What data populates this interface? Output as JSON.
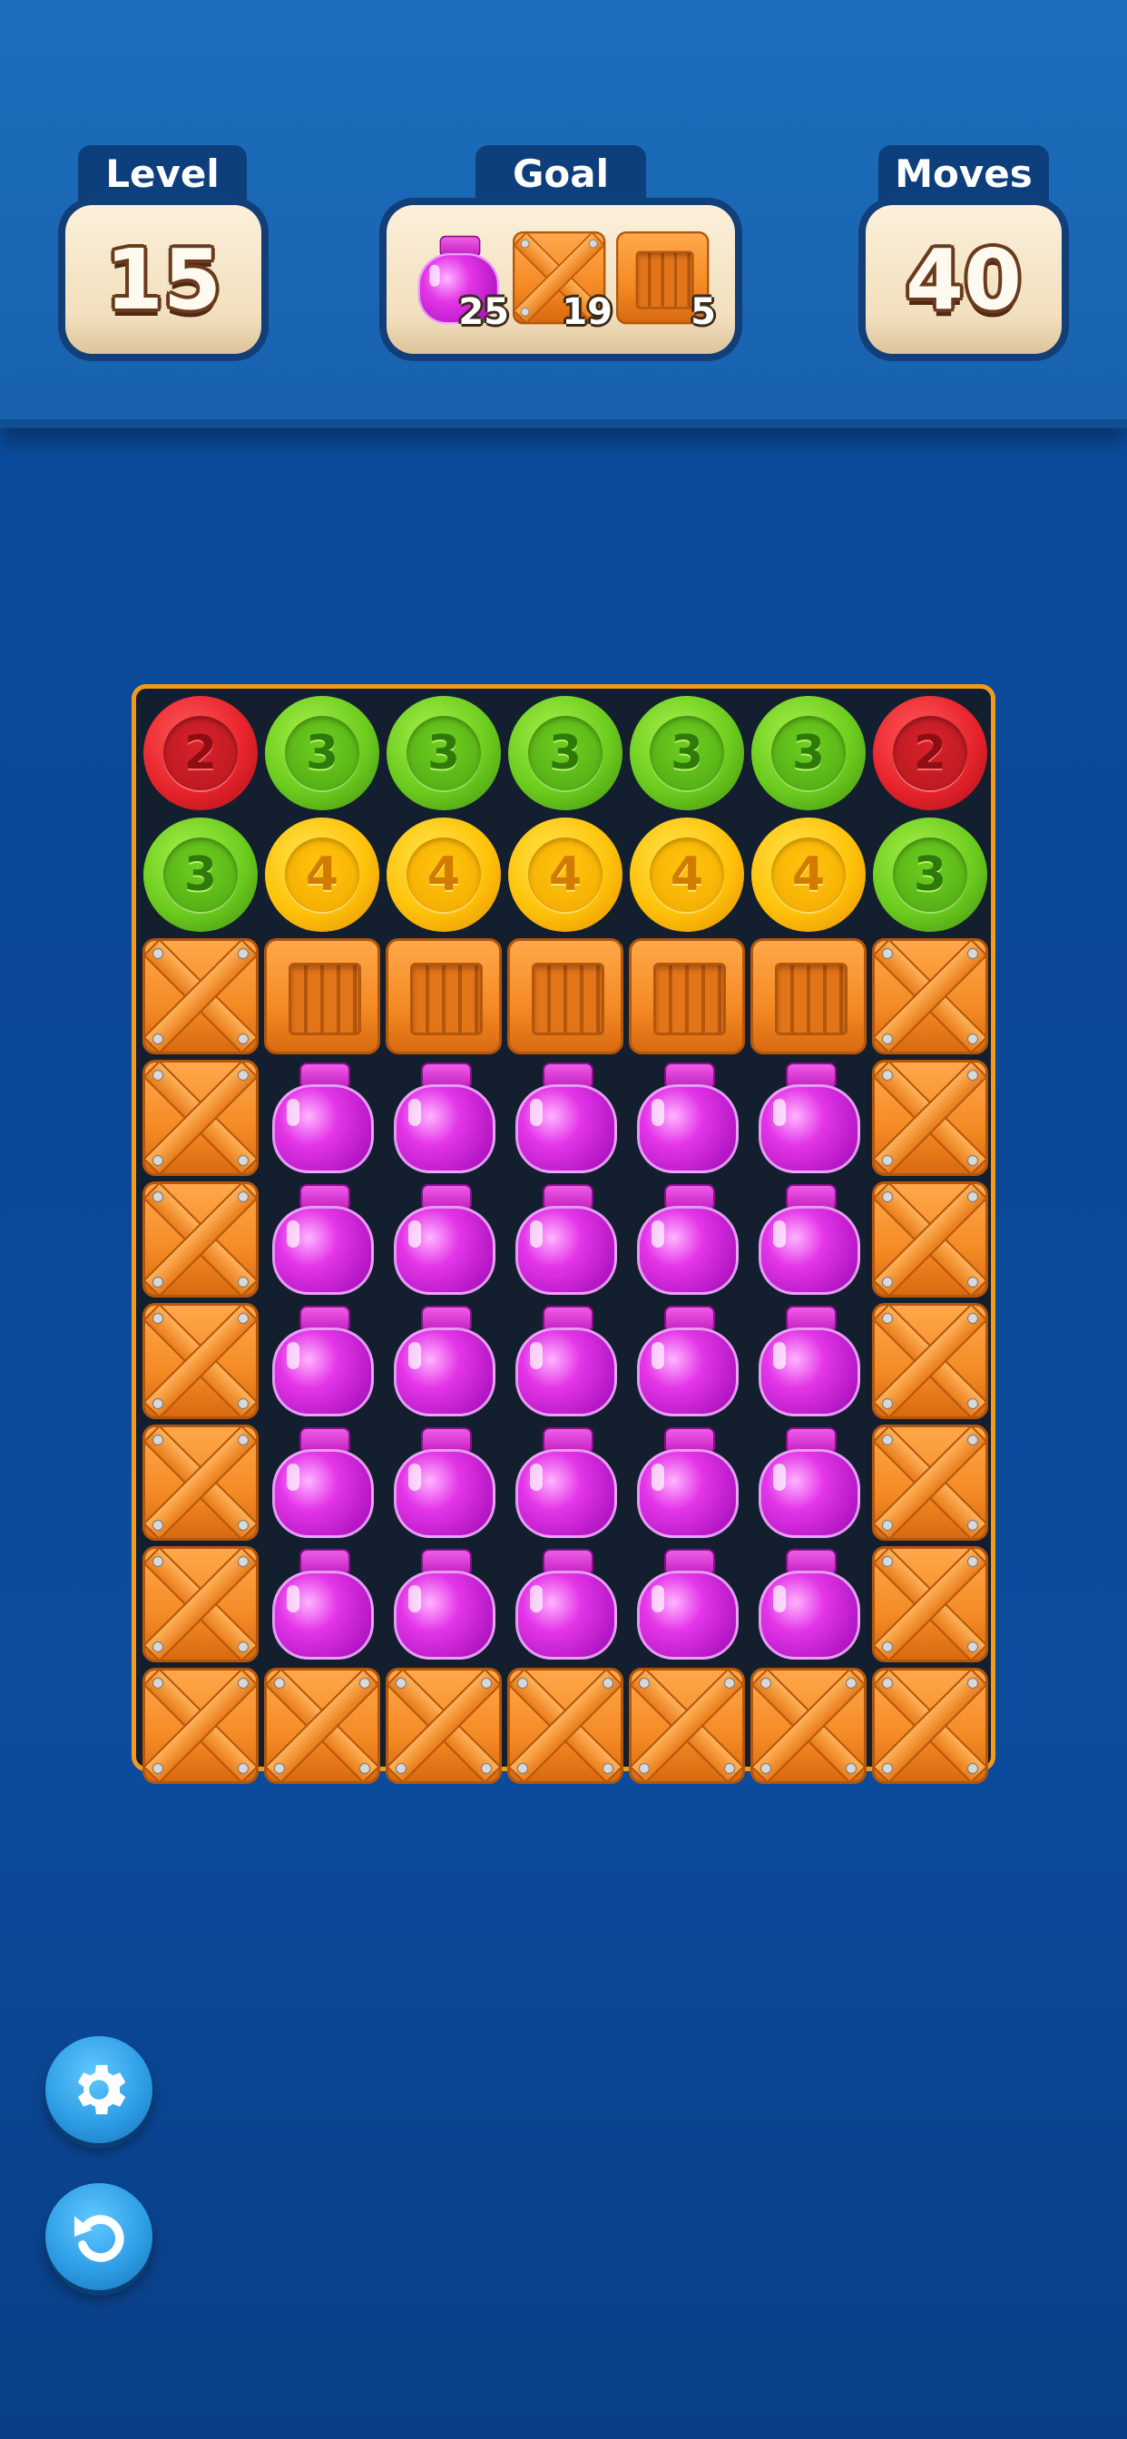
{
  "hud": {
    "level": {
      "label": "Level",
      "value": "15"
    },
    "goal": {
      "label": "Goal",
      "items": [
        {
          "icon": "jar-icon",
          "count": "25"
        },
        {
          "icon": "crate-icon",
          "count": "19"
        },
        {
          "icon": "plank-icon",
          "count": "5"
        }
      ]
    },
    "moves": {
      "label": "Moves",
      "value": "40"
    }
  },
  "board": {
    "rows": [
      [
        "chip-red:2",
        "chip-green:3",
        "chip-green:3",
        "chip-green:3",
        "chip-green:3",
        "chip-green:3",
        "chip-red:2"
      ],
      [
        "chip-green:3",
        "chip-yellow:4",
        "chip-yellow:4",
        "chip-yellow:4",
        "chip-yellow:4",
        "chip-yellow:4",
        "chip-green:3"
      ],
      [
        "crate",
        "plank",
        "plank",
        "plank",
        "plank",
        "plank",
        "crate"
      ],
      [
        "crate",
        "jar",
        "jar",
        "jar",
        "jar",
        "jar",
        "crate"
      ],
      [
        "crate",
        "jar",
        "jar",
        "jar",
        "jar",
        "jar",
        "crate"
      ],
      [
        "crate",
        "jar",
        "jar",
        "jar",
        "jar",
        "jar",
        "crate"
      ],
      [
        "crate",
        "jar",
        "jar",
        "jar",
        "jar",
        "jar",
        "crate"
      ],
      [
        "crate",
        "jar",
        "jar",
        "jar",
        "jar",
        "jar",
        "crate"
      ],
      [
        "crate",
        "crate",
        "crate",
        "crate",
        "crate",
        "crate",
        "crate"
      ]
    ]
  },
  "controls": {
    "settings_icon": "gear-icon",
    "undo_icon": "undo-icon"
  },
  "colors": {
    "board_border": "#f29a1d",
    "background": "#0a4897",
    "header": "#1a67b4"
  }
}
